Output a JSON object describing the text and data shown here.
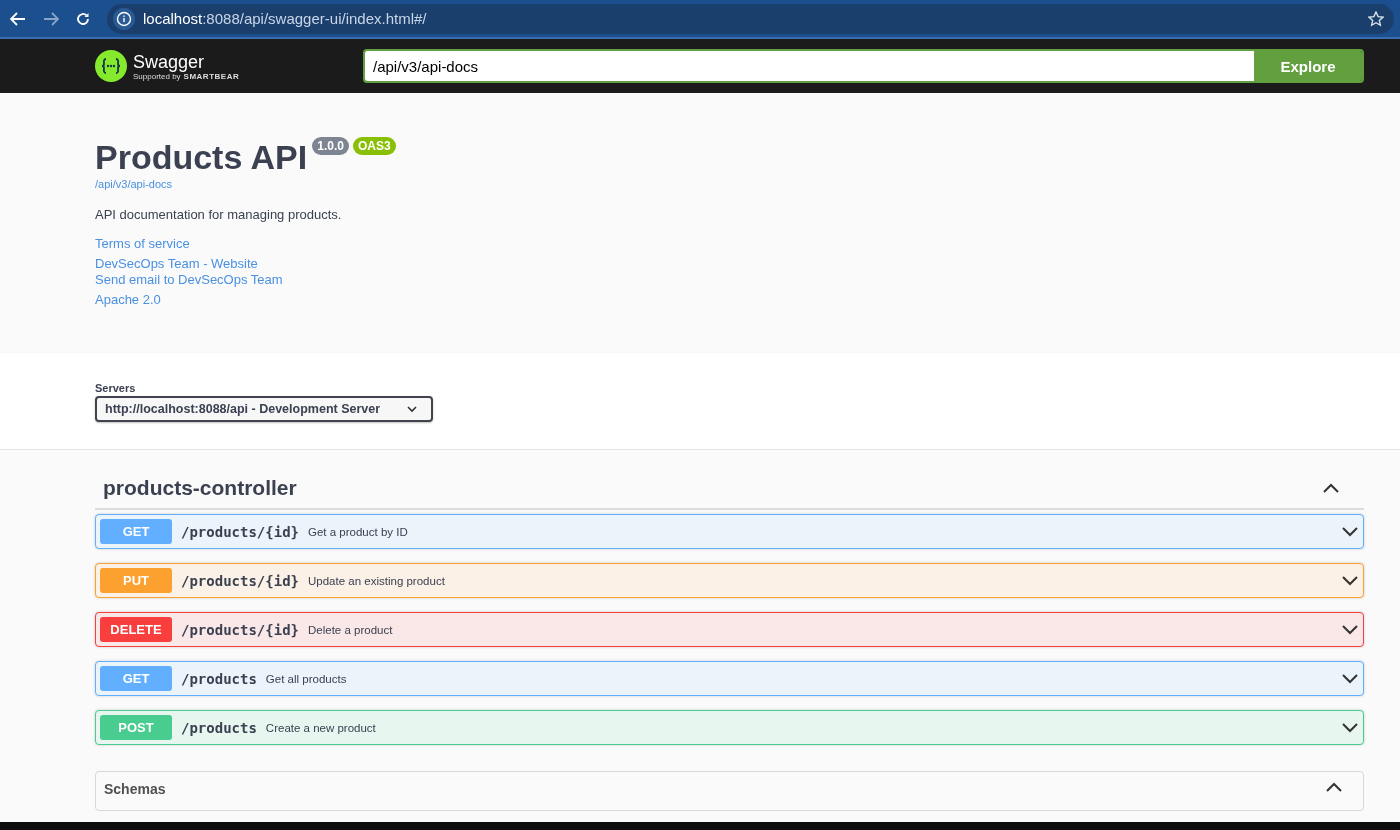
{
  "browser": {
    "url": {
      "host": "localhost",
      "path": ":8088/api/swagger-ui/index.html#/"
    }
  },
  "topbar": {
    "logo_text": "Swagger",
    "logo_sub": "Supported by",
    "logo_brand": "SMARTBEAR",
    "spec_url": "/api/v3/api-docs",
    "explore": "Explore"
  },
  "info": {
    "title": "Products API",
    "version": "1.0.0",
    "oas": "OAS3",
    "spec_link": "/api/v3/api-docs",
    "description": "API documentation for managing products.",
    "link_groups": [
      [
        "Terms of service"
      ],
      [
        "DevSecOps Team - Website",
        "Send email to DevSecOps Team"
      ],
      [
        "Apache 2.0"
      ]
    ]
  },
  "servers": {
    "label": "Servers",
    "selected_server": "http://localhost:8088/api - Development Server"
  },
  "tag": {
    "name": "products-controller",
    "expanded": true,
    "operations": [
      {
        "method": "GET",
        "path": "/products/{id}",
        "summary": "Get a product by ID",
        "expanded": false
      },
      {
        "method": "PUT",
        "path": "/products/{id}",
        "summary": "Update an existing product",
        "expanded": false
      },
      {
        "method": "DELETE",
        "path": "/products/{id}",
        "summary": "Delete a product",
        "expanded": false
      },
      {
        "method": "GET",
        "path": "/products",
        "summary": "Get all products",
        "expanded": false
      },
      {
        "method": "POST",
        "path": "/products",
        "summary": "Create a new product",
        "expanded": false
      }
    ]
  },
  "schemas": {
    "title": "Schemas",
    "expanded": true
  }
}
